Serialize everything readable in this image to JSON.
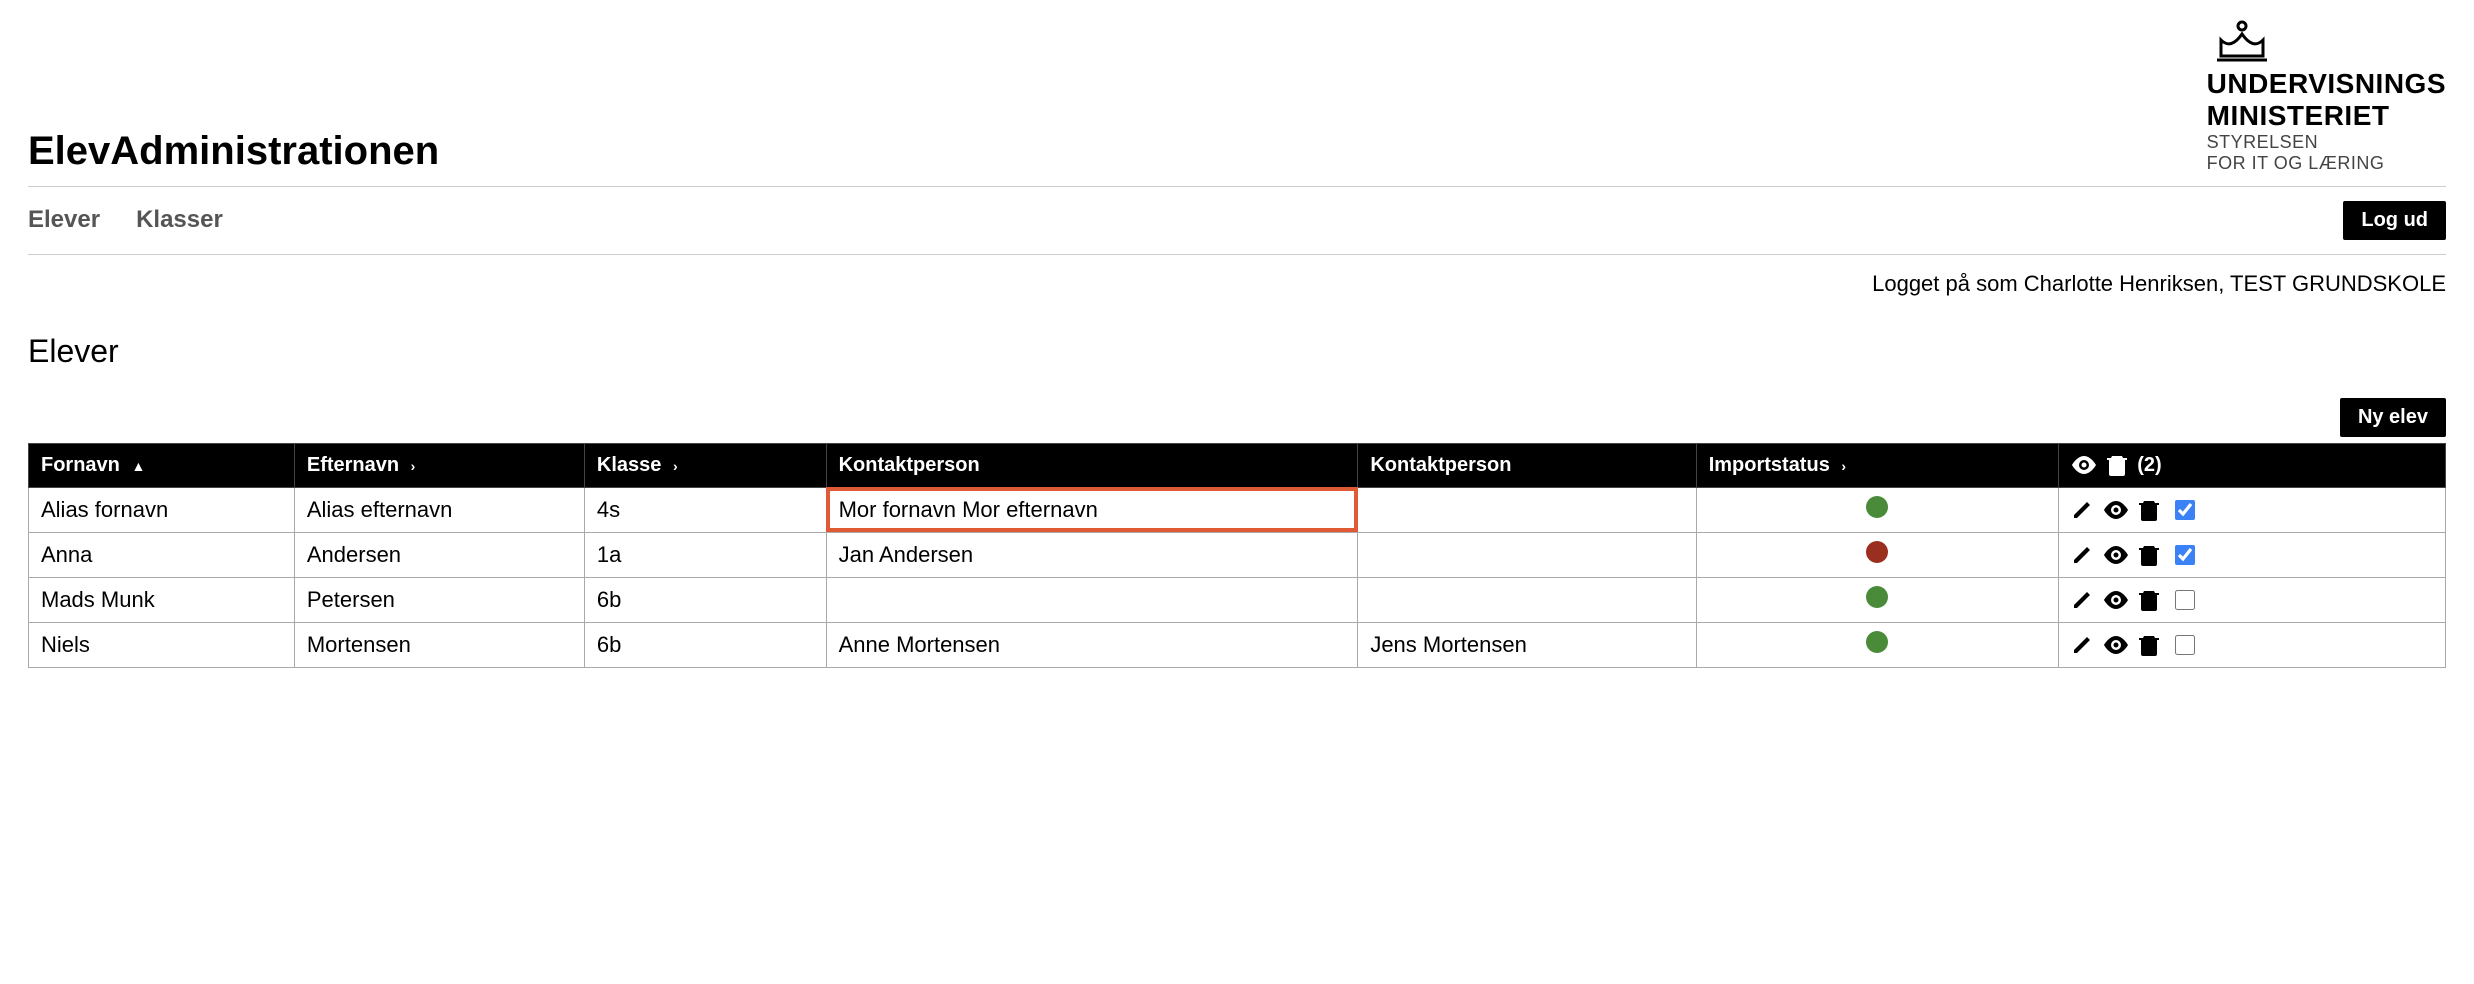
{
  "header": {
    "site_title": "ElevAdministrationen",
    "logo": {
      "line1": "UNDERVISNINGS",
      "line2": "MINISTERIET",
      "line3": "STYRELSEN",
      "line4": "FOR IT OG LÆRING"
    }
  },
  "nav": {
    "items": [
      "Elever",
      "Klasser"
    ],
    "logout_label": "Log ud"
  },
  "logged_in_text": "Logget på som Charlotte Henriksen, TEST GRUNDSKOLE",
  "page": {
    "title": "Elever",
    "new_button": "Ny elev"
  },
  "table": {
    "columns": {
      "fornavn": "Fornavn",
      "efternavn": "Efternavn",
      "klasse": "Klasse",
      "kontakt1": "Kontaktperson",
      "kontakt2": "Kontaktperson",
      "importstatus": "Importstatus",
      "selected_count": "(2)"
    },
    "rows": [
      {
        "fornavn": "Alias fornavn",
        "efternavn": "Alias efternavn",
        "klasse": "4s",
        "kontakt1": "Mor fornavn Mor efternavn",
        "kontakt2": "",
        "status": "green",
        "checked": true,
        "highlight_kontakt1": true
      },
      {
        "fornavn": "Anna",
        "efternavn": "Andersen",
        "klasse": "1a",
        "kontakt1": "Jan Andersen",
        "kontakt2": "",
        "status": "red",
        "checked": true,
        "highlight_kontakt1": false
      },
      {
        "fornavn": "Mads Munk",
        "efternavn": "Petersen",
        "klasse": "6b",
        "kontakt1": "",
        "kontakt2": "",
        "status": "green",
        "checked": false,
        "highlight_kontakt1": false
      },
      {
        "fornavn": "Niels",
        "efternavn": "Mortensen",
        "klasse": "6b",
        "kontakt1": "Anne Mortensen",
        "kontakt2": "Jens Mortensen",
        "status": "green",
        "checked": false,
        "highlight_kontakt1": false
      }
    ]
  }
}
